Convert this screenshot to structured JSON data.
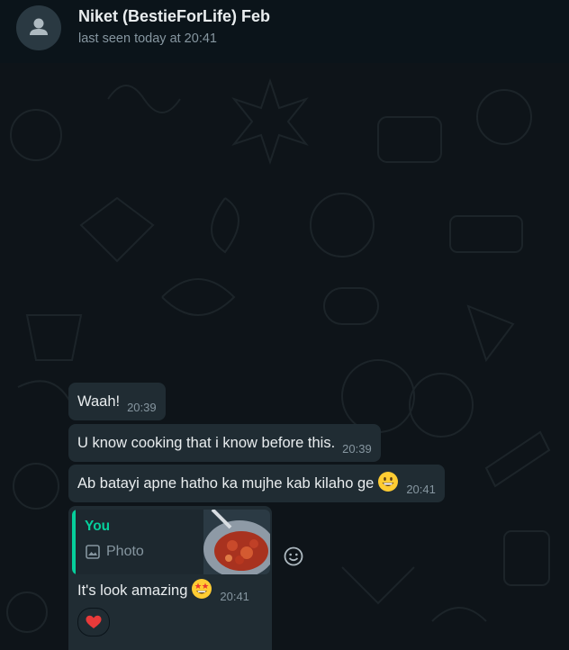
{
  "header": {
    "contact_name": "Niket (BestieForLife) Feb",
    "status": "last seen today at 20:41",
    "avatar_icon": "person-icon"
  },
  "messages": [
    {
      "text": "Waah!",
      "time": "20:39"
    },
    {
      "text": "U know cooking that i know before this.",
      "time": "20:39"
    },
    {
      "text": "Ab batayi apne hatho ka mujhe kab kilaho ge",
      "time": "20:41",
      "emoji": "grinning-face-icon"
    }
  ],
  "reply": {
    "quote_author": "You",
    "quote_type": "Photo",
    "quote_icon": "image-icon",
    "text": "It's look amazing",
    "emoji": "star-struck-icon",
    "time": "20:41",
    "reaction": "red-heart-icon",
    "react_button_icon": "smiley-icon"
  },
  "colors": {
    "background": "#0b141a",
    "bubble": "#202c33",
    "accent": "#06cf9c",
    "muted": "#8696a0"
  }
}
